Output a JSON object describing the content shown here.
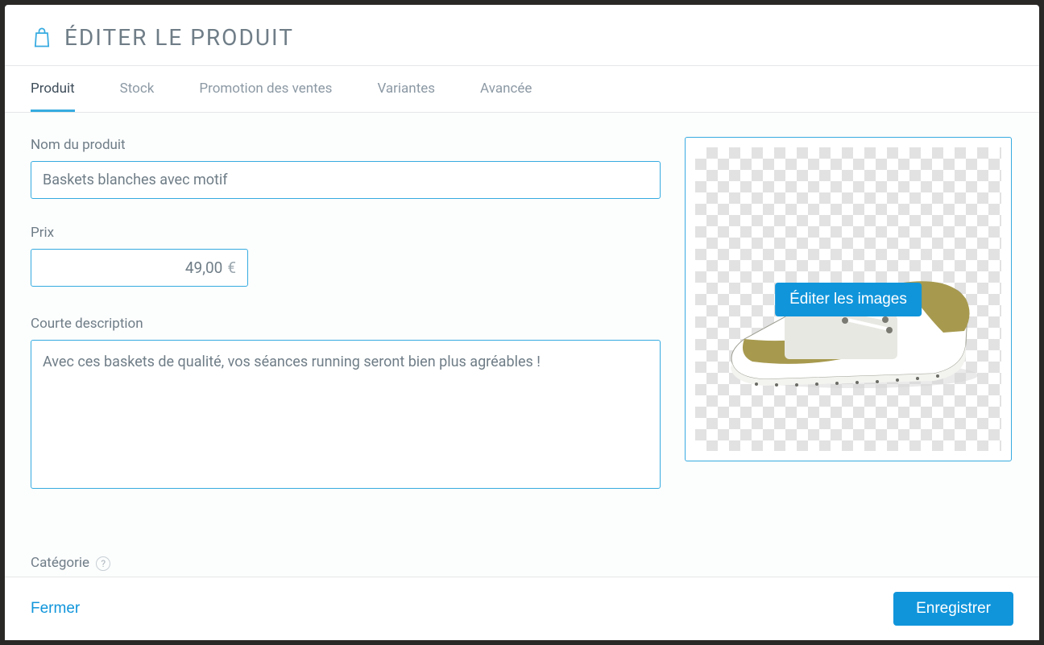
{
  "modal": {
    "title": "ÉDITER LE PRODUIT",
    "icon_name": "shopping-bag-icon"
  },
  "tabs": [
    {
      "id": "produit",
      "label": "Produit",
      "active": true
    },
    {
      "id": "stock",
      "label": "Stock",
      "active": false
    },
    {
      "id": "promo",
      "label": "Promotion des ventes",
      "active": false
    },
    {
      "id": "variantes",
      "label": "Variantes",
      "active": false
    },
    {
      "id": "avancee",
      "label": "Avancée",
      "active": false
    }
  ],
  "fields": {
    "name": {
      "label": "Nom du produit",
      "value": "Baskets blanches avec motif"
    },
    "price": {
      "label": "Prix",
      "value": "49,00",
      "currency": "€"
    },
    "short_description": {
      "label": "Courte description",
      "value": "Avec ces baskets de qualité, vos séances running seront bien plus agréables !"
    },
    "category": {
      "label": "Catégorie"
    }
  },
  "image_panel": {
    "edit_label": "Éditer les images",
    "product_depicted": "white-and-olive-sneaker"
  },
  "footer": {
    "close_label": "Fermer",
    "save_label": "Enregistrer"
  },
  "colors": {
    "accent": "#1095db",
    "border_active": "#36abe0",
    "text_muted": "#6f7d87"
  }
}
